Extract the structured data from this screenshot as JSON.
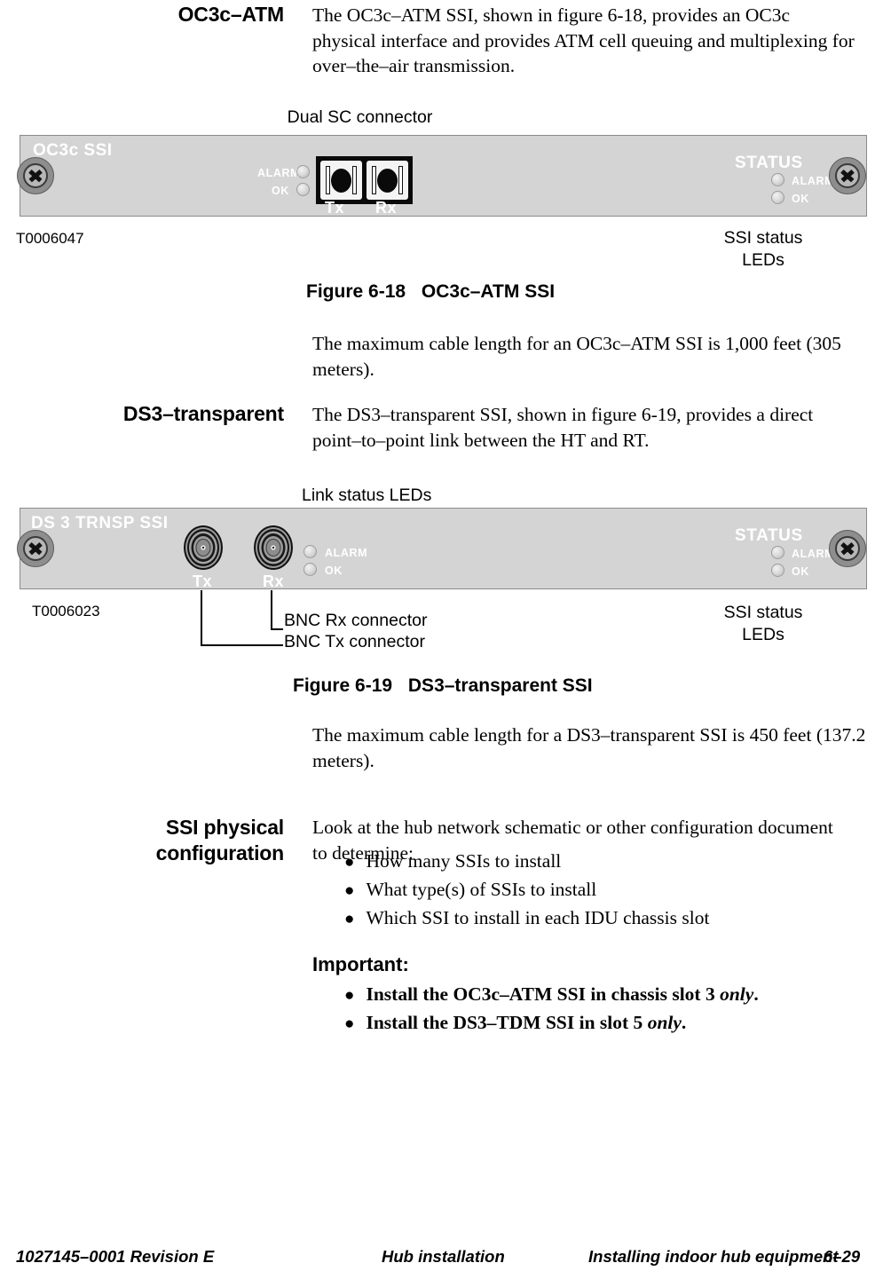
{
  "sections": {
    "oc3c": {
      "heading": "OC3c–ATM",
      "body": "The OC3c–ATM SSI, shown in figure 6-18, provides an OC3c physical interface and provides ATM cell queuing and multiplexing for over–the–air transmission.",
      "cable_note": "The maximum cable length for an OC3c–ATM SSI is 1,000 feet (305 meters)."
    },
    "ds3": {
      "heading": "DS3–transparent",
      "body": "The DS3–transparent SSI, shown in figure 6-19, provides a direct point–to–point link between the HT and RT.",
      "cable_note": "The maximum cable length for a DS3–transparent SSI is 450 feet (137.2 meters)."
    },
    "physical_config": {
      "heading_line1": "SSI physical",
      "heading_line2": "configuration",
      "body": "Look at the hub network schematic or other configuration document to determine:",
      "bullets": [
        "How many SSIs to install",
        "What type(s) of SSIs to install",
        "Which SSI to install in each IDU chassis slot"
      ],
      "important_label": "Important:",
      "important_bullets": [
        {
          "text": "Install the OC3c–ATM SSI in chassis slot 3 ",
          "emphasis": "only",
          "tail": "."
        },
        {
          "text": "Install the DS3–TDM SSI in slot 5 ",
          "emphasis": "only",
          "tail": "."
        }
      ]
    }
  },
  "figure_oc3c": {
    "caption_label": "Figure",
    "caption_number": "6-18",
    "caption_title": "OC3c–ATM SSI",
    "drawing_number": "T0006047",
    "panel_label": "OC3c SSI",
    "status_title": "STATUS",
    "status_leds": [
      "ALARM",
      "OK"
    ],
    "link_leds": [
      "ALARM",
      "OK"
    ],
    "port_tx": "Tx",
    "port_rx": "Rx",
    "callout_top": "Dual SC connector",
    "callout_right_line1": "SSI status",
    "callout_right_line2": "LEDs"
  },
  "figure_ds3": {
    "caption_label": "Figure",
    "caption_number": "6-19",
    "caption_title": "DS3–transparent SSI",
    "drawing_number": "T0006023",
    "panel_label": "DS 3 TRNSP SSI",
    "status_title": "STATUS",
    "status_leds": [
      "ALARM",
      "OK"
    ],
    "link_leds": [
      "ALARM",
      "OK"
    ],
    "port_tx": "Tx",
    "port_rx": "Rx",
    "callout_top": "Link status LEDs",
    "callout_rx": "BNC Rx connector",
    "callout_tx": "BNC Tx connector",
    "callout_right_line1": "SSI status",
    "callout_right_line2": "LEDs"
  },
  "footer": {
    "left": "1027145–0001  Revision E",
    "center": "Hub installation",
    "right": "Installing indoor hub equipment",
    "page": "6–29"
  },
  "colors": {
    "panel_face": "#d4d4d4",
    "panel_border": "#8a8a8a",
    "panel_text": "#ffffff",
    "ink": "#000000"
  }
}
